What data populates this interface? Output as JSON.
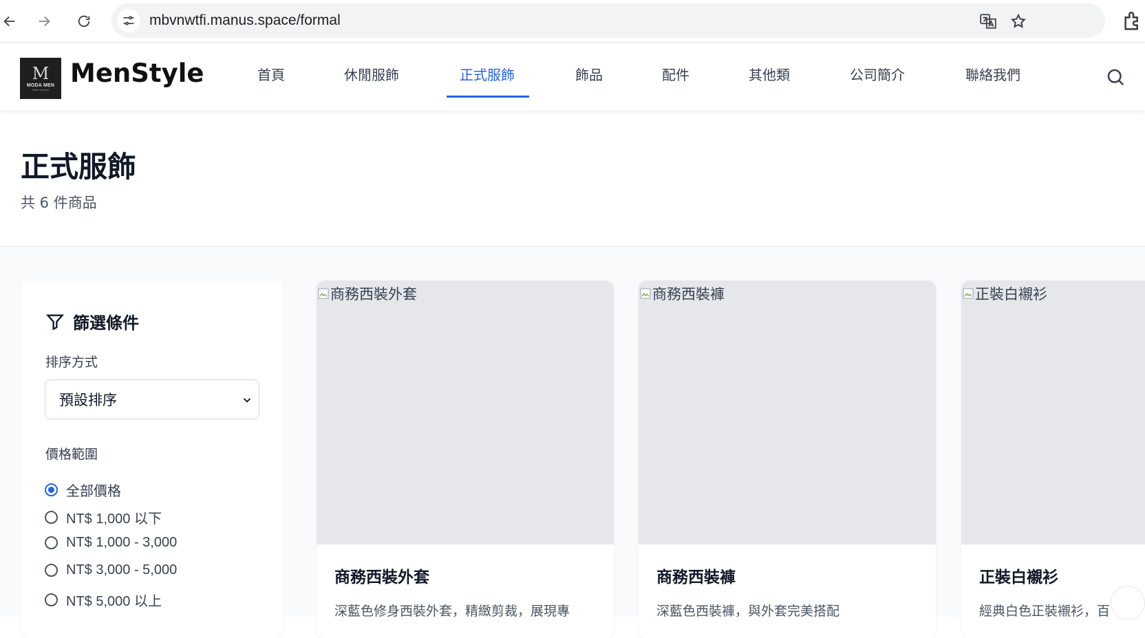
{
  "browser": {
    "url": "mbvnwtfi.manus.space/formal",
    "icons": [
      "back-icon",
      "forward-icon",
      "reload-icon",
      "site-info-icon",
      "translate-icon",
      "star-icon",
      "extensions-icon"
    ]
  },
  "header": {
    "brand": "MenStyle",
    "logo": {
      "mark": "M",
      "text": "MODA MEN",
      "tagline": "MEN'S FASHION"
    },
    "menu": [
      {
        "label": "首頁",
        "active": false
      },
      {
        "label": "休閒服飾",
        "active": false
      },
      {
        "label": "正式服飾",
        "active": true
      },
      {
        "label": "飾品",
        "active": false
      },
      {
        "label": "配件",
        "active": false
      },
      {
        "label": "其他類",
        "active": false
      },
      {
        "label": "公司簡介",
        "active": false
      },
      {
        "label": "聯絡我們",
        "active": false
      }
    ]
  },
  "page": {
    "title": "正式服飾",
    "count": "共 6 件商品"
  },
  "filter": {
    "title": "篩選條件",
    "sort_label": "排序方式",
    "sort_value": "預設排序",
    "price_label": "價格範圍",
    "price_options": [
      {
        "label": "全部價格",
        "checked": true
      },
      {
        "label": "NT$ 1,000 以下",
        "checked": false
      },
      {
        "label": "NT$ 1,000 - 3,000",
        "checked": false
      },
      {
        "label": "NT$ 3,000 - 5,000",
        "checked": false
      },
      {
        "label": "NT$ 5,000 以上",
        "checked": false
      }
    ]
  },
  "products": [
    {
      "alt": "商務西裝外套",
      "name": "商務西裝外套",
      "desc": "深藍色修身西裝外套，精緻剪裁，展現專"
    },
    {
      "alt": "商務西裝褲",
      "name": "商務西裝褲",
      "desc": "深藍色西裝褲，與外套完美搭配"
    },
    {
      "alt": "正裝白襯衫",
      "name": "正裝白襯衫",
      "desc": "經典白色正裝襯衫，百"
    }
  ],
  "colors": {
    "accent": "#2563eb",
    "text": "#111827",
    "muted": "#4b5563",
    "placeholder": "#e5e7eb"
  }
}
